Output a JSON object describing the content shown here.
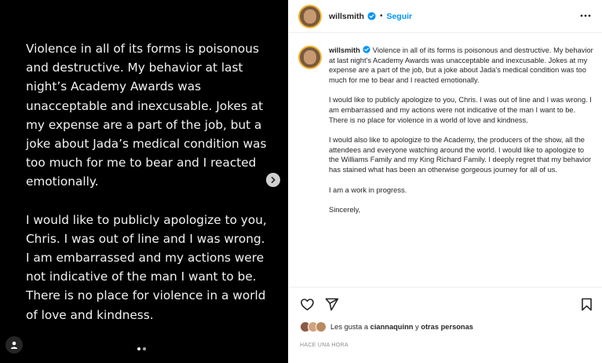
{
  "media": {
    "paragraphs": [
      "Violence in all of its forms is poisonous and destructive. My behavior at last night’s Academy Awards was unacceptable and inexcusable. Jokes at my expense are a part of the job, but a joke about Jada’s medical condition was too much for me to bear and I reacted emotionally.",
      "I would like to publicly apologize to you, Chris. I was out of line and I was wrong. I am embarrassed and my actions were not indicative of the man I want to be. There is no place for violence in a world of love and kindness."
    ],
    "carousel": {
      "count": 2,
      "active_index": 0
    },
    "icons": {
      "next": "chevron-right-icon",
      "tag": "user-tag-icon"
    }
  },
  "header": {
    "username": "willsmith",
    "separator": "•",
    "follow_label": "Seguir",
    "icons": {
      "verified": "verified-badge-icon",
      "more": "more-options-icon"
    }
  },
  "caption": {
    "username": "willsmith",
    "paragraphs": [
      "Violence in all of its forms is poisonous and destructive. My behavior at last night's Academy Awards was unacceptable and inexcusable. Jokes at my expense are a part of the job, but a joke about Jada's medical condition was too much for me to bear and I reacted emotionally.",
      "I would like to publicly apologize to you, Chris. I was out of line and I was wrong. I am embarrassed and my actions were not indicative of the man I want to be. There is no place for violence in a world of love and kindness.",
      "I would also like to apologize to the Academy, the producers of the show, all the attendees and everyone watching around the world. I would like to apologize to the Williams Family and my King Richard Family. I deeply regret that my behavior has stained what has been an otherwise gorgeous journey for all of us.",
      "I am a work in progress.",
      "Sincerely,"
    ]
  },
  "actions": {
    "icons": {
      "like": "heart-icon",
      "share": "send-icon",
      "save": "bookmark-icon"
    }
  },
  "likes": {
    "prefix": "Les gusta a",
    "user": "ciannaquinn",
    "connector": "y",
    "others": "otras personas"
  },
  "timestamp": "HACE UNA HORA",
  "colors": {
    "accent": "#0095f6",
    "text": "#262626",
    "muted": "#8e8e8e",
    "media_bg": "#000000",
    "story_ring": "#f2b632"
  }
}
